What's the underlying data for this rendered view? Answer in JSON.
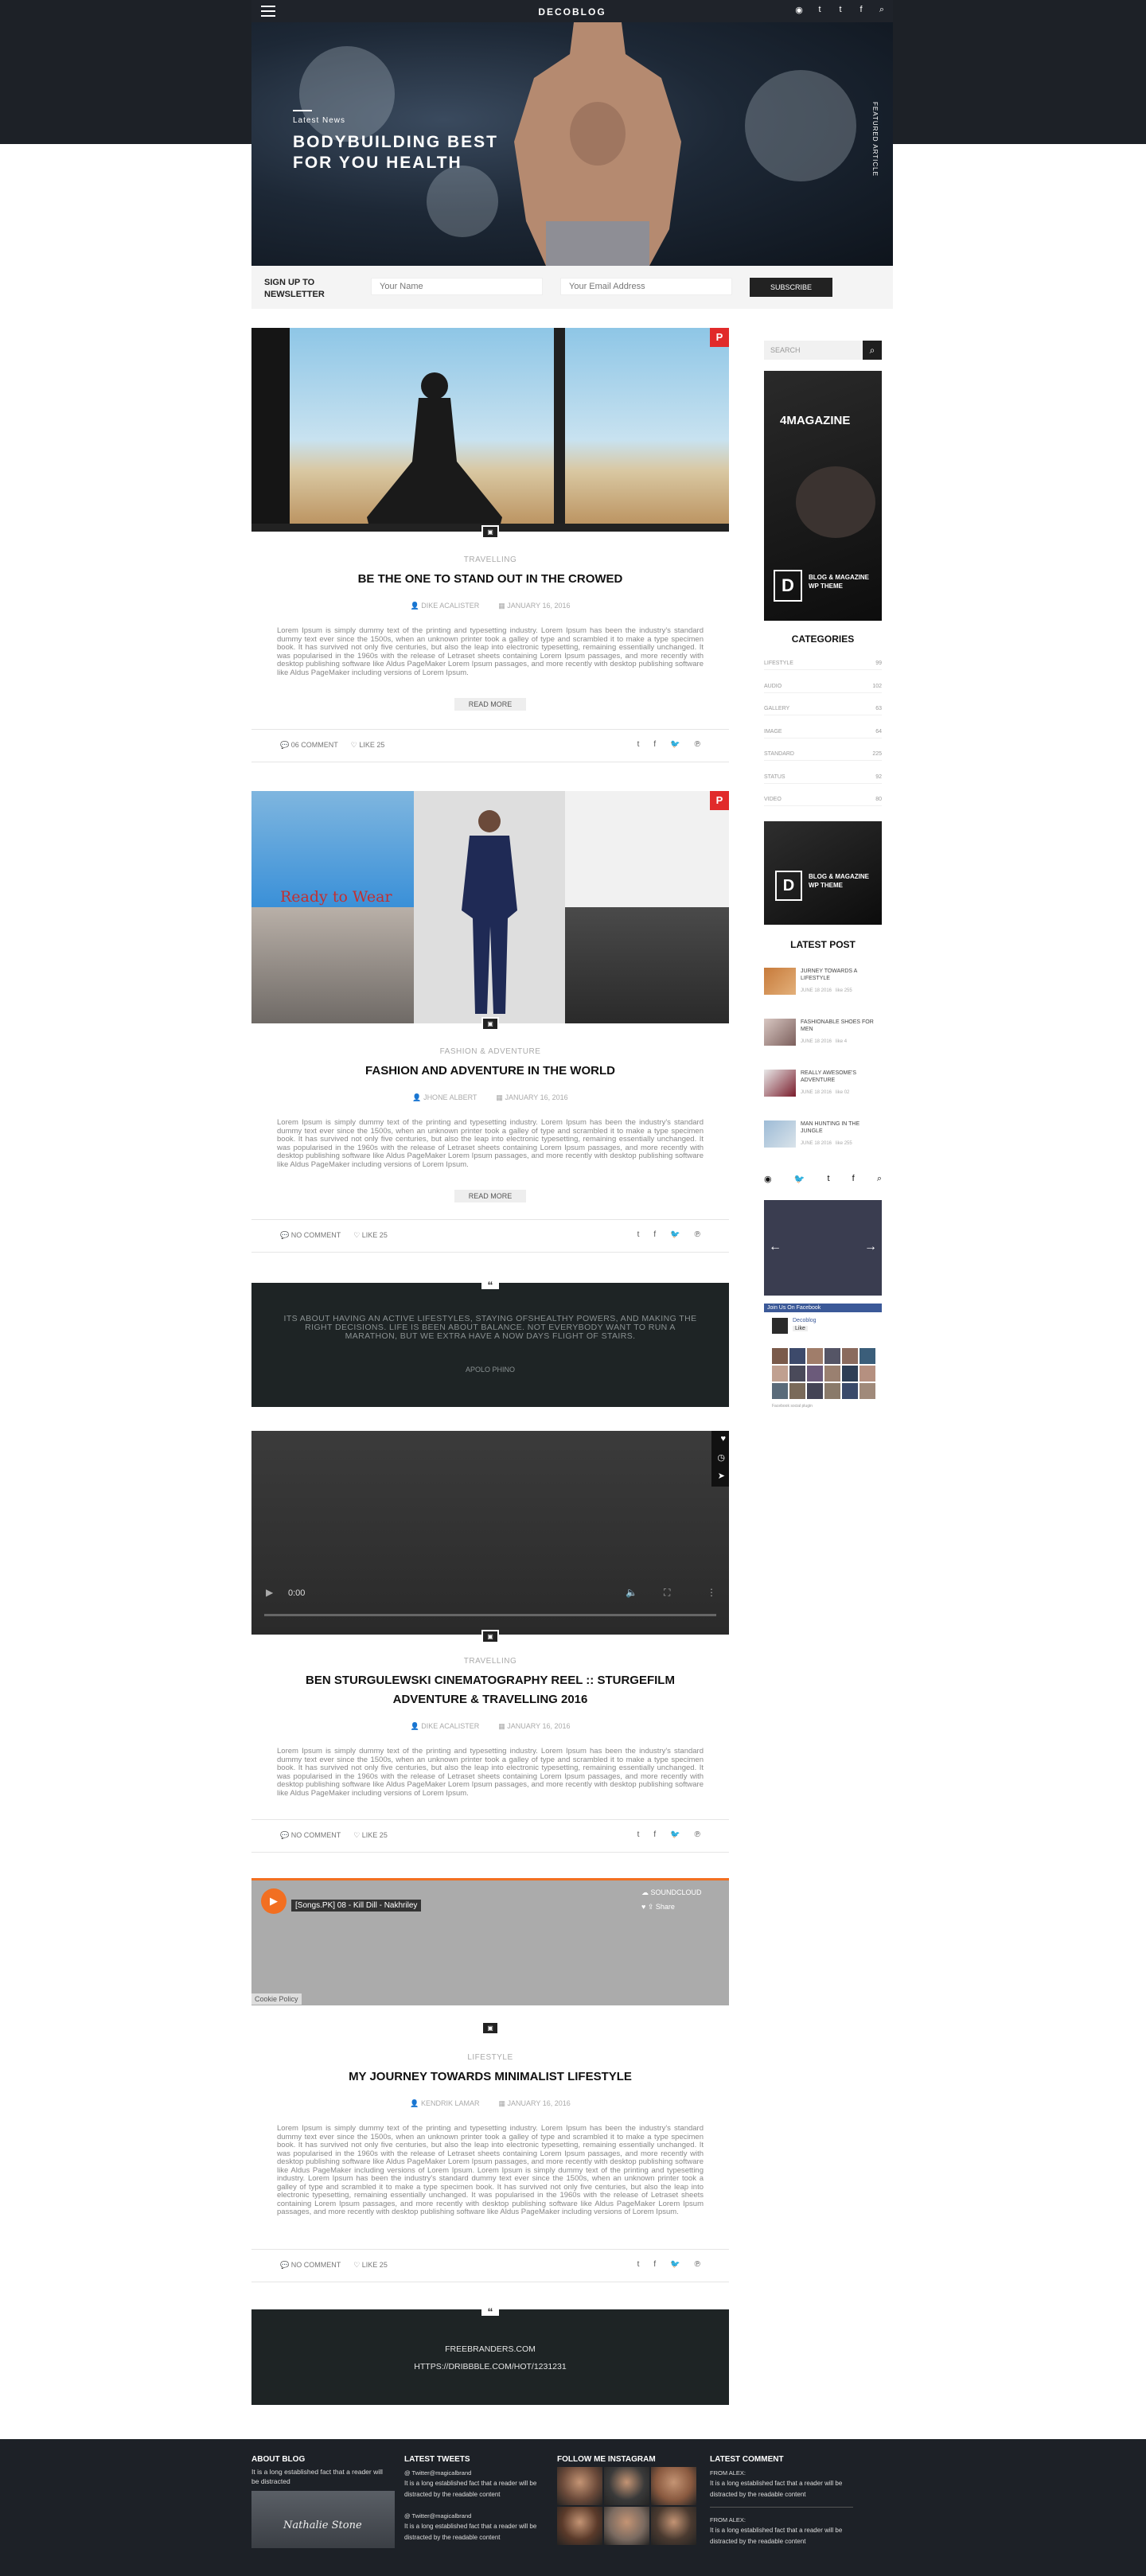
{
  "nav": {
    "logo": "DECOBLOG",
    "icons": [
      "rss-icon",
      "twitter-icon",
      "tumblr-icon",
      "facebook-icon",
      "search-icon"
    ]
  },
  "hero": {
    "tag": "Latest News",
    "title": "BODYBUILDING BEST FOR YOU HEALTH",
    "vertical": "FEATURED ARTICLE"
  },
  "newsletter": {
    "label_line1": "SIGN UP TO",
    "label_line2": "NEWSLETTER",
    "name_placeholder": "Your Name",
    "email_placeholder": "Your Email Address",
    "button": "SUBSCRIBE"
  },
  "posts": [
    {
      "category": "TRAVELLING",
      "title": "BE THE ONE TO STAND OUT IN THE CROWED",
      "author": "DIKE ACALISTER",
      "date": "JANUARY 16, 2016",
      "excerpt": "Lorem Ipsum is simply dummy text of the printing and typesetting industry. Lorem Ipsum has been the industry's standard dummy text ever since the 1500s, when an unknown printer took a galley of type and scrambled it to make a type specimen book. It has survived not only five centuries, but also the leap into electronic typesetting, remaining essentially unchanged. It was popularised in the 1960s with the release of Letraset sheets containing Lorem Ipsum passages, and more recently with desktop publishing software like Aldus PageMaker Lorem Ipsum passages, and more recently with desktop publishing software like Aldus PageMaker including versions of Lorem Ipsum.",
      "readmore": "READ MORE",
      "comments": "06 COMMENT",
      "likes": "LIKE 25"
    },
    {
      "category": "FASHION & ADVENTURE",
      "title": "FASHION AND ADVENTURE IN THE WORLD",
      "author": "JHONE ALBERT",
      "date": "JANUARY 16, 2016",
      "excerpt": "Lorem Ipsum is simply dummy text of the printing and typesetting industry. Lorem Ipsum has been the industry's standard dummy text ever since the 1500s, when an unknown printer took a galley of type and scrambled it to make a type specimen book. It has survived not only five centuries, but also the leap into electronic typesetting, remaining essentially unchanged. It was popularised in the 1960s with the release of Letraset sheets containing Lorem Ipsum passages, and more recently with desktop publishing software like Aldus PageMaker Lorem Ipsum passages, and more recently with desktop publishing software like Aldus PageMaker including versions of Lorem Ipsum.",
      "readmore": "READ MORE",
      "comments": "NO COMMENT",
      "likes": "LIKE 25",
      "image_caption": "Ready to Wear"
    },
    {
      "category": "TRAVELLING",
      "title": "BEN STURGULEWSKI CINEMATOGRAPHY REEL :: STURGEFILM ADVENTURE & TRAVELLING 2016",
      "author": "DIKE ACALISTER",
      "date": "JANUARY 16, 2016",
      "excerpt": "Lorem Ipsum is simply dummy text of the printing and typesetting industry. Lorem Ipsum has been the industry's standard dummy text ever since the 1500s, when an unknown printer took a galley of type and scrambled it to make a type specimen book. It has survived not only five centuries, but also the leap into electronic typesetting, remaining essentially unchanged. It was popularised in the 1960s with the release of Letraset sheets containing Lorem Ipsum passages, and more recently with desktop publishing software like Aldus PageMaker Lorem Ipsum passages, and more recently with desktop publishing software like Aldus PageMaker including versions of Lorem Ipsum.",
      "comments": "NO COMMENT",
      "likes": "LIKE 25",
      "video_time": "0:00"
    },
    {
      "category": "LIFESTYLE",
      "title": "MY JOURNEY TOWARDS MINIMALIST LIFESTYLE",
      "author": "KENDRIK LAMAR",
      "date": "JANUARY 16, 2016",
      "excerpt": "Lorem Ipsum is simply dummy text of the printing and typesetting industry. Lorem Ipsum has been the industry's standard dummy text ever since the 1500s, when an unknown printer took a galley of type and scrambled it to make a type specimen book. It has survived not only five centuries, but also the leap into electronic typesetting, remaining essentially unchanged. It was popularised in the 1960s with the release of Letraset sheets containing Lorem Ipsum passages, and more recently with desktop publishing software like Aldus PageMaker Lorem Ipsum passages, and more recently with desktop publishing software like Aldus PageMaker including versions of Lorem Ipsum. Lorem Ipsum is simply dummy text of the printing and typesetting industry. Lorem Ipsum has been the industry's standard dummy text ever since the 1500s, when an unknown printer took a galley of type and scrambled it to make a type specimen book. It has survived not only five centuries, but also the leap into electronic typesetting, remaining essentially unchanged. It was popularised in the 1960s with the release of Letraset sheets containing Lorem Ipsum passages, and more recently with desktop publishing software like Aldus PageMaker Lorem Ipsum passages, and more recently with desktop publishing software like Aldus PageMaker including versions of Lorem Ipsum.",
      "comments": "NO COMMENT",
      "likes": "LIKE 25",
      "sound_track": "[Songs.PK] 08 - Kill Dill - Nakhriley",
      "soundcloud": "SOUNDCLOUD",
      "share": "Share",
      "cookie": "Cookie Policy"
    }
  ],
  "quote1": {
    "text": "ITS ABOUT HAVING AN ACTIVE LIFESTYLES, STAYING OFSHEALTHY POWERS, AND MAKING THE RIGHT DECISIONS. LIFE IS BEEN ABOUT BALANCE. NOT EVERYBODY WANT TO RUN A MARATHON, BUT WE EXTRA HAVE A NOW DAYS FLIGHT OF STAIRS.",
    "author": "APOLO PHINO"
  },
  "quote2": {
    "line1": "FREEBRANDERS.COM",
    "line2": "HTTPS://DRIBBBLE.COM/HOT/1231231"
  },
  "sidebar": {
    "search_placeholder": "SEARCH",
    "ad_title": "4MAGAZINE",
    "ad_text": "BLOG & MAGAZINE WP THEME",
    "categories_title": "CATEGORIES",
    "categories": [
      {
        "name": "LIFESTYLE",
        "count": "99"
      },
      {
        "name": "AUDIO",
        "count": "102"
      },
      {
        "name": "GALLERY",
        "count": "63"
      },
      {
        "name": "IMAGE",
        "count": "64"
      },
      {
        "name": "STANDARD",
        "count": "225"
      },
      {
        "name": "STATUS",
        "count": "92"
      },
      {
        "name": "VIDEO",
        "count": "80"
      }
    ],
    "latest_title": "LATEST POST",
    "latest": [
      {
        "title": "JURNEY TOWARDS A LIFESTYLE",
        "date": "JUNE 18 2016",
        "likes": "like 255"
      },
      {
        "title": "FASHIONABLE SHOES FOR MEN",
        "date": "JUNE 18 2016",
        "likes": "like 4"
      },
      {
        "title": "REALLY AWESOME'S ADVENTURE",
        "date": "JUNE 18 2016",
        "likes": "like 02"
      },
      {
        "title": "MAN HUNTING IN THE JUNGLE",
        "date": "JUNE 18 2016",
        "likes": "like 255"
      }
    ],
    "fb_header": "Join Us On Facebook",
    "fb_name": "Decoblog",
    "fb_like": "Like",
    "fb_footer": "Facebook social plugin"
  },
  "footer": {
    "about_title": "ABOUT BLOG",
    "about_text": "It is a long established fact that a reader will be distracted",
    "signature": "Nathalie Stone",
    "tweets_title": "LATEST TWEETS",
    "tweets": [
      {
        "handle": "@ Twitter@magicalbrand",
        "text": "It is a long established fact that a reader will be distracted by the readable content"
      },
      {
        "handle": "@ Twitter@magicalbrand",
        "text": "It is a long established fact that a reader will be distracted by the readable content"
      }
    ],
    "insta_title": "FOLLOW ME INSTAGRAM",
    "comment_title": "LATEST COMMENT",
    "comments": [
      {
        "from": "FROM ALEX:",
        "text": "It is a long established fact that a reader will be distracted by the readable content"
      },
      {
        "from": "FROM ALEX:",
        "text": "It is a long established fact that a reader will be distracted by the readable content"
      }
    ]
  }
}
